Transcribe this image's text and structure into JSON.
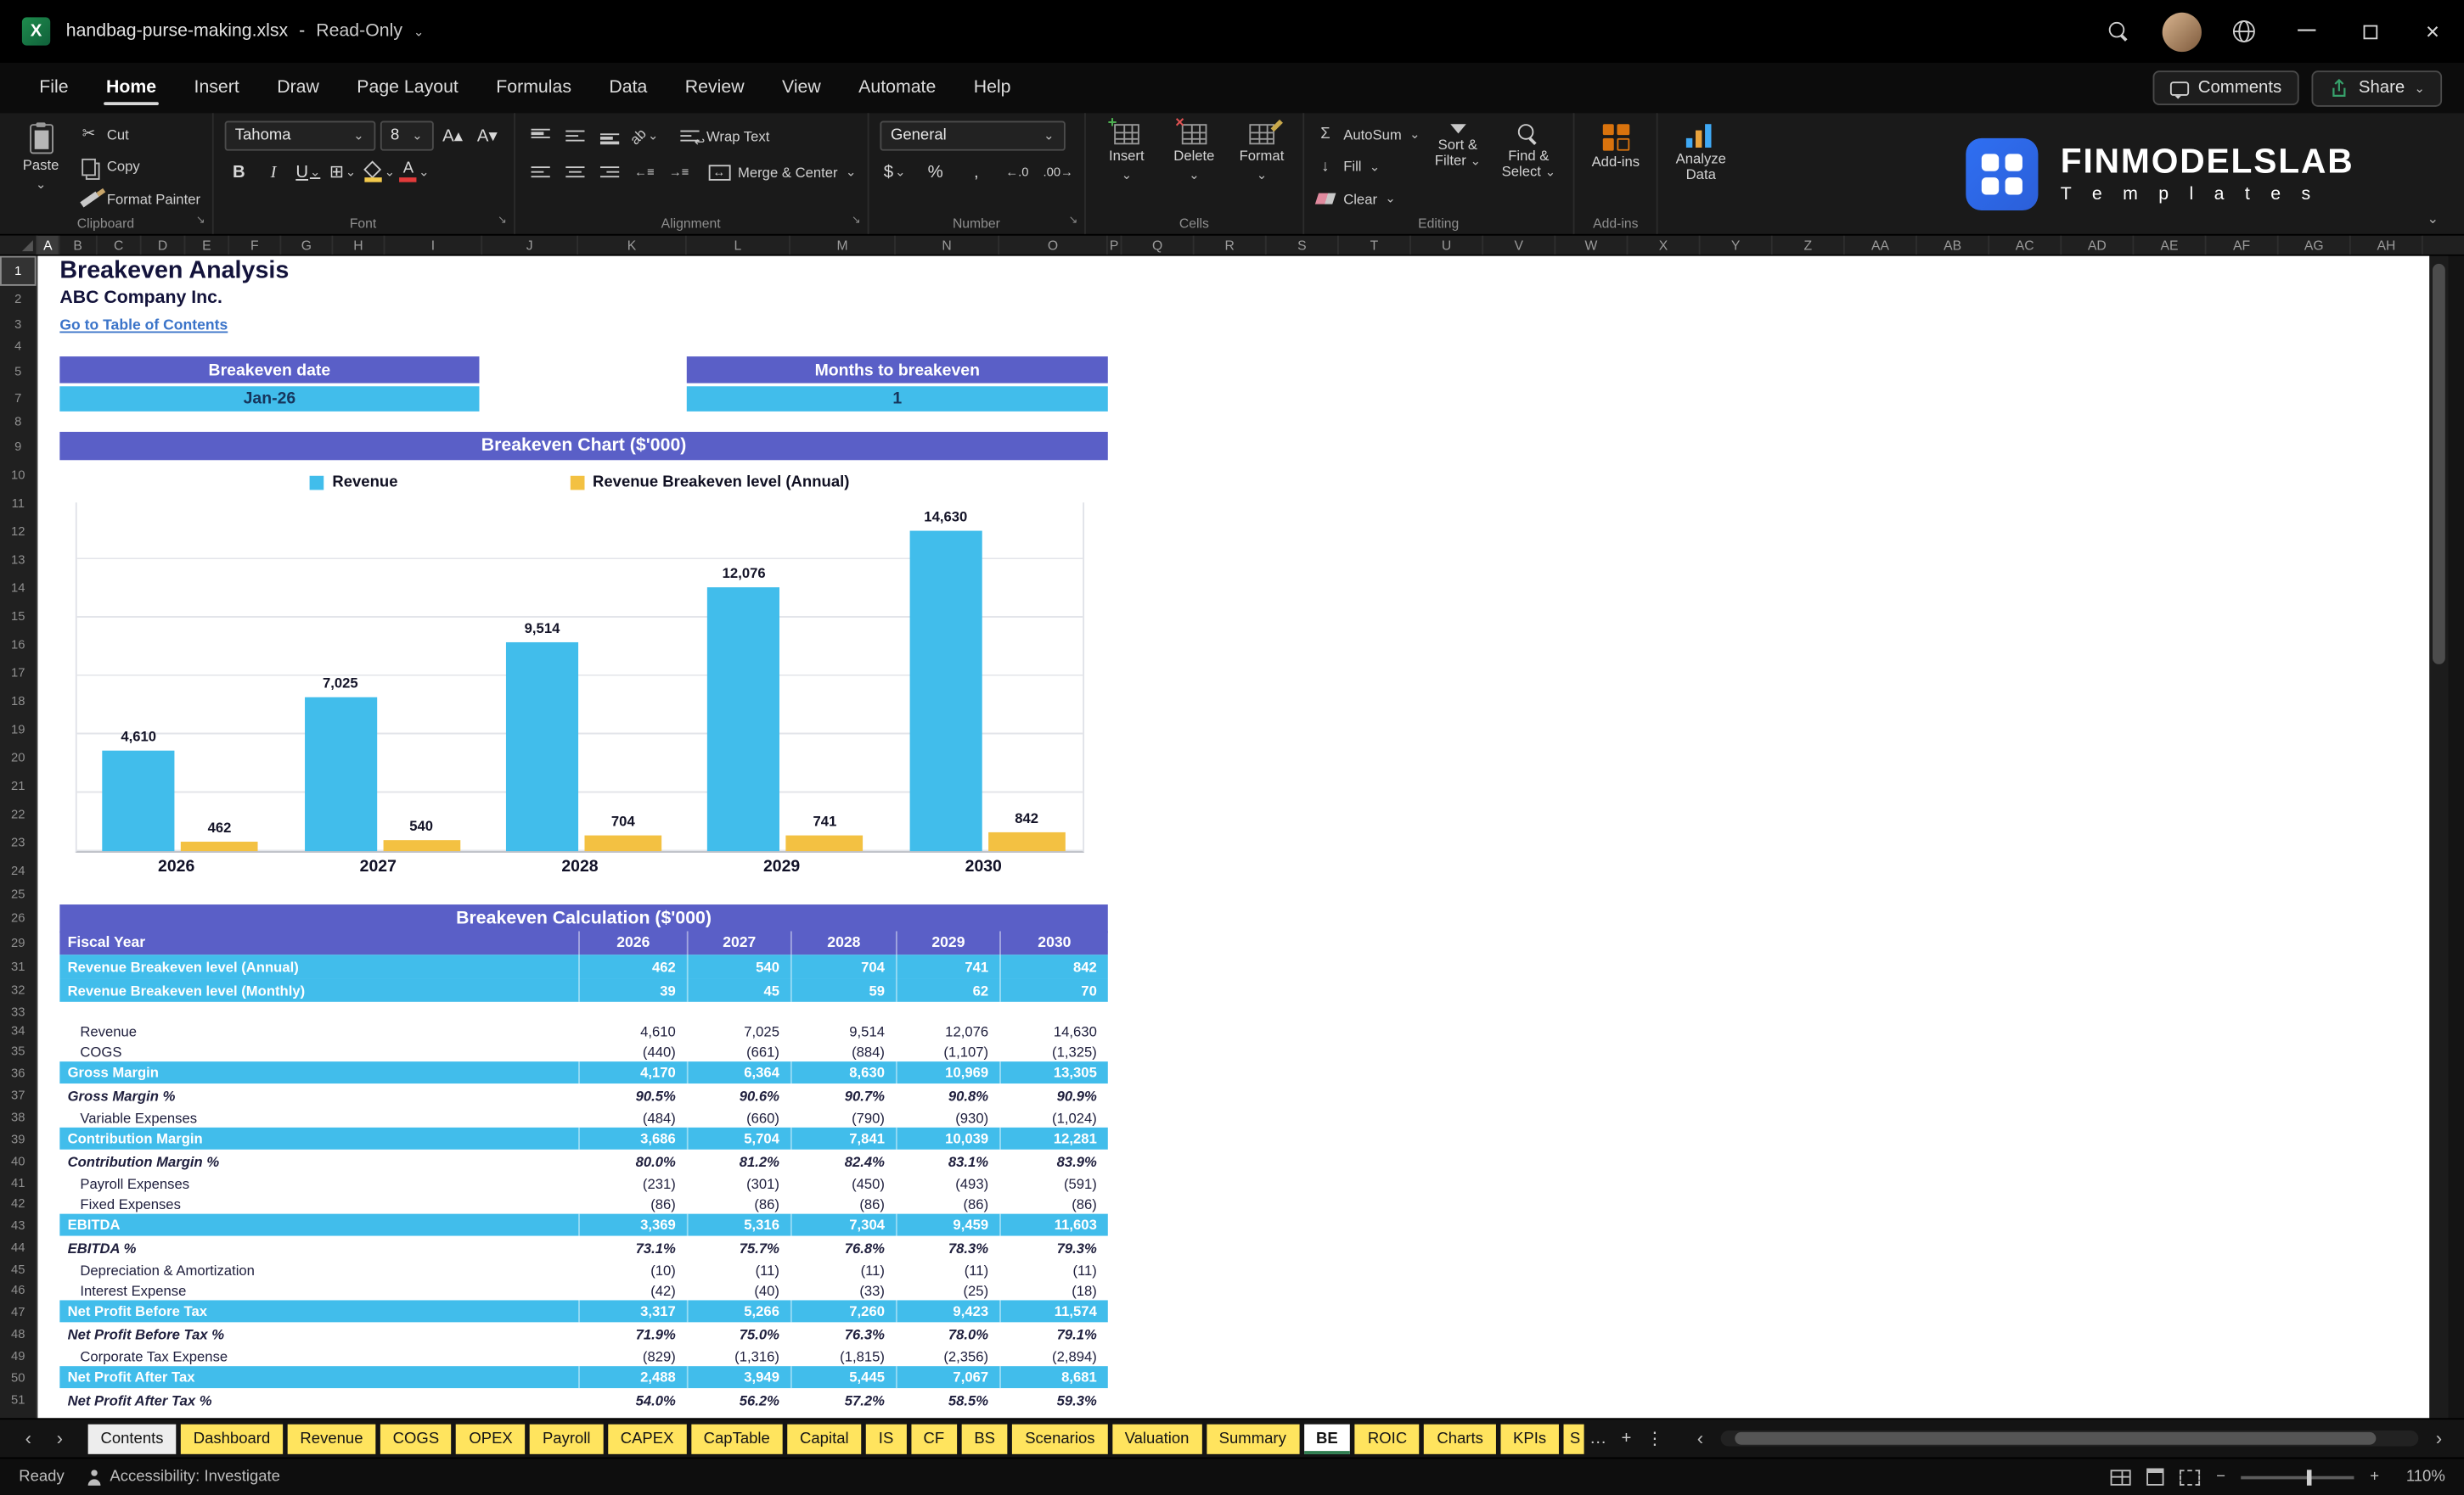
{
  "icons": {
    "chevron": "⌄",
    "dropdown": "▾",
    "scissors": "✂",
    "bold": "B",
    "italic": "I",
    "underline": "U",
    "border": "⊞",
    "sigma": "Σ",
    "fill_down": "↓",
    "wrap_arrow": "↩",
    "merge_arrow": "↔",
    "orientation": "ab",
    "minimize": "─",
    "close": "×",
    "nav_left": "‹",
    "nav_right": "›",
    "more": "…",
    "add_sheet": "+",
    "dots": "⋮",
    "dollar": "$",
    "percent": "%",
    "comma": ",",
    "dec_inc": "←.0",
    "dec_dec": ".00→",
    "font_up": "A▴",
    "font_down": "A▾"
  },
  "titlebar": {
    "filename": "handbag-purse-making.xlsx",
    "separator": "-",
    "mode": "Read-Only"
  },
  "menubar": {
    "items": [
      "File",
      "Home",
      "Insert",
      "Draw",
      "Page Layout",
      "Formulas",
      "Data",
      "Review",
      "View",
      "Automate",
      "Help"
    ],
    "active": "Home",
    "comments_label": "Comments",
    "share_label": "Share"
  },
  "ribbon": {
    "clipboard": {
      "label": "Clipboard",
      "paste": "Paste",
      "cut": "Cut",
      "copy": "Copy",
      "format_painter": "Format Painter"
    },
    "font": {
      "label": "Font",
      "family": "Tahoma",
      "size": "8"
    },
    "alignment": {
      "label": "Alignment",
      "wrap": "Wrap Text",
      "merge": "Merge & Center"
    },
    "number": {
      "label": "Number",
      "format": "General"
    },
    "cells": {
      "label": "Cells",
      "insert": "Insert",
      "delete": "Delete",
      "format": "Format"
    },
    "editing": {
      "label": "Editing",
      "autosum": "AutoSum",
      "fill": "Fill",
      "clear": "Clear",
      "sort1": "Sort &",
      "sort2": "Filter",
      "find1": "Find &",
      "find2": "Select"
    },
    "addins": {
      "label": "Add-ins",
      "addins": "Add-ins",
      "analyze1": "Analyze",
      "analyze2": "Data"
    },
    "logo": {
      "line1": "FINMODELSLAB",
      "line2": "T e m p l a t e s"
    }
  },
  "sheet": {
    "selected_col": "A",
    "selected_row": 1,
    "columns": [
      {
        "l": "A",
        "w": 14
      },
      {
        "l": "B",
        "w": 24
      },
      {
        "l": "C",
        "w": 28
      },
      {
        "l": "D",
        "w": 28
      },
      {
        "l": "E",
        "w": 28
      },
      {
        "l": "F",
        "w": 33
      },
      {
        "l": "G",
        "w": 33
      },
      {
        "l": "H",
        "w": 33
      },
      {
        "l": "I",
        "w": 62
      },
      {
        "l": "J",
        "w": 61
      },
      {
        "l": "K",
        "w": 69
      },
      {
        "l": "L",
        "w": 66
      },
      {
        "l": "M",
        "w": 67
      },
      {
        "l": "N",
        "w": 66
      },
      {
        "l": "O",
        "w": 69
      },
      {
        "l": "P",
        "w": 9
      },
      {
        "l": "Q",
        "w": 46
      },
      {
        "l": "R",
        "w": 46
      },
      {
        "l": "S",
        "w": 46
      },
      {
        "l": "T",
        "w": 46
      },
      {
        "l": "U",
        "w": 46
      },
      {
        "l": "V",
        "w": 46
      },
      {
        "l": "W",
        "w": 46
      },
      {
        "l": "X",
        "w": 46
      },
      {
        "l": "Y",
        "w": 46
      },
      {
        "l": "Z",
        "w": 46
      },
      {
        "l": "AA",
        "w": 46
      },
      {
        "l": "AB",
        "w": 46
      },
      {
        "l": "AC",
        "w": 46
      },
      {
        "l": "AD",
        "w": 46
      },
      {
        "l": "AE",
        "w": 46
      },
      {
        "l": "AF",
        "w": 46
      },
      {
        "l": "AG",
        "w": 46
      },
      {
        "l": "AH",
        "w": 46
      }
    ],
    "rows": [
      [
        1,
        19
      ],
      [
        2,
        16
      ],
      [
        3,
        16
      ],
      [
        4,
        13
      ],
      [
        5,
        18
      ],
      [
        7,
        17
      ],
      [
        8,
        13
      ],
      [
        9,
        18
      ],
      [
        10,
        18
      ],
      [
        11,
        18
      ],
      [
        12,
        18
      ],
      [
        13,
        18
      ],
      [
        14,
        18
      ],
      [
        15,
        18
      ],
      [
        16,
        18
      ],
      [
        17,
        18
      ],
      [
        18,
        18
      ],
      [
        19,
        18
      ],
      [
        20,
        18
      ],
      [
        21,
        18
      ],
      [
        22,
        18
      ],
      [
        23,
        18
      ],
      [
        24,
        18
      ],
      [
        25,
        13
      ],
      [
        26,
        17
      ],
      [
        29,
        15
      ],
      [
        31,
        15
      ],
      [
        32,
        15
      ],
      [
        33,
        12
      ],
      [
        34,
        13
      ],
      [
        35,
        13
      ],
      [
        36,
        14
      ],
      [
        37,
        15
      ],
      [
        38,
        13
      ],
      [
        39,
        14
      ],
      [
        40,
        15
      ],
      [
        41,
        13
      ],
      [
        42,
        13
      ],
      [
        43,
        14
      ],
      [
        44,
        15
      ],
      [
        45,
        13
      ],
      [
        46,
        13
      ],
      [
        47,
        14
      ],
      [
        48,
        15
      ],
      [
        49,
        13
      ],
      [
        50,
        14
      ],
      [
        51,
        15
      ]
    ],
    "title": "Breakeven Analysis",
    "company": "ABC Company Inc.",
    "toc_link": "Go to Table of Contents",
    "breakeven_date_label": "Breakeven date",
    "breakeven_date": "Jan-26",
    "months_label": "Months to breakeven",
    "months_value": "1",
    "chart_banner": "Breakeven Chart ($'000)",
    "calc_banner": "Breakeven Calculation ($'000)"
  },
  "chart_data": {
    "type": "bar",
    "title": "Breakeven Chart ($'000)",
    "categories": [
      "2026",
      "2027",
      "2028",
      "2029",
      "2030"
    ],
    "series": [
      {
        "name": "Revenue",
        "color": "#41BDEB",
        "values": [
          4610,
          7025,
          9514,
          12076,
          14630
        ],
        "labels": [
          "4,610",
          "7,025",
          "9,514",
          "12,076",
          "14,630"
        ]
      },
      {
        "name": "Revenue Breakeven level (Annual)",
        "color": "#F3C142",
        "values": [
          462,
          540,
          704,
          741,
          842
        ],
        "labels": [
          "462",
          "540",
          "704",
          "741",
          "842"
        ]
      }
    ],
    "ylim": [
      0,
      16000
    ],
    "gridline_intervals": 6,
    "legend_position": "top",
    "grid": true
  },
  "calc_table": {
    "header": {
      "label": "Fiscal Year",
      "years": [
        "2026",
        "2027",
        "2028",
        "2029",
        "2030"
      ]
    },
    "rows": [
      {
        "row": "31",
        "label": "Revenue Breakeven level (Annual)",
        "values": [
          "462",
          "540",
          "704",
          "741",
          "842"
        ],
        "style": "blue"
      },
      {
        "row": "32",
        "label": "Revenue Breakeven level (Monthly)",
        "values": [
          "39",
          "45",
          "59",
          "62",
          "70"
        ],
        "style": "blue"
      },
      {
        "row": "33",
        "label": "",
        "values": [
          "",
          "",
          "",
          "",
          ""
        ],
        "style": "spacer"
      },
      {
        "row": "34",
        "label": "Revenue",
        "values": [
          "4,610",
          "7,025",
          "9,514",
          "12,076",
          "14,630"
        ],
        "style": "normal"
      },
      {
        "row": "35",
        "label": "COGS",
        "values": [
          "(440)",
          "(661)",
          "(884)",
          "(1,107)",
          "(1,325)"
        ],
        "style": "normal"
      },
      {
        "row": "36",
        "label": "Gross Margin",
        "values": [
          "4,170",
          "6,364",
          "8,630",
          "10,969",
          "13,305"
        ],
        "style": "blue-sub"
      },
      {
        "row": "37",
        "label": "Gross Margin %",
        "values": [
          "90.5%",
          "90.6%",
          "90.7%",
          "90.8%",
          "90.9%"
        ],
        "style": "pct"
      },
      {
        "row": "38",
        "label": "Variable Expenses",
        "values": [
          "(484)",
          "(660)",
          "(790)",
          "(930)",
          "(1,024)"
        ],
        "style": "normal"
      },
      {
        "row": "39",
        "label": "Contribution Margin",
        "values": [
          "3,686",
          "5,704",
          "7,841",
          "10,039",
          "12,281"
        ],
        "style": "blue-sub"
      },
      {
        "row": "40",
        "label": "Contribution Margin %",
        "values": [
          "80.0%",
          "81.2%",
          "82.4%",
          "83.1%",
          "83.9%"
        ],
        "style": "pct"
      },
      {
        "row": "41",
        "label": "Payroll Expenses",
        "values": [
          "(231)",
          "(301)",
          "(450)",
          "(493)",
          "(591)"
        ],
        "style": "normal"
      },
      {
        "row": "42",
        "label": "Fixed Expenses",
        "values": [
          "(86)",
          "(86)",
          "(86)",
          "(86)",
          "(86)"
        ],
        "style": "normal"
      },
      {
        "row": "43",
        "label": "EBITDA",
        "values": [
          "3,369",
          "5,316",
          "7,304",
          "9,459",
          "11,603"
        ],
        "style": "blue-sub"
      },
      {
        "row": "44",
        "label": "EBITDA %",
        "values": [
          "73.1%",
          "75.7%",
          "76.8%",
          "78.3%",
          "79.3%"
        ],
        "style": "pct"
      },
      {
        "row": "45",
        "label": "Depreciation & Amortization",
        "values": [
          "(10)",
          "(11)",
          "(11)",
          "(11)",
          "(11)"
        ],
        "style": "normal"
      },
      {
        "row": "46",
        "label": "Interest Expense",
        "values": [
          "(42)",
          "(40)",
          "(33)",
          "(25)",
          "(18)"
        ],
        "style": "normal"
      },
      {
        "row": "47",
        "label": "Net Profit Before Tax",
        "values": [
          "3,317",
          "5,266",
          "7,260",
          "9,423",
          "11,574"
        ],
        "style": "blue-sub"
      },
      {
        "row": "48",
        "label": "Net Profit Before Tax %",
        "values": [
          "71.9%",
          "75.0%",
          "76.3%",
          "78.0%",
          "79.1%"
        ],
        "style": "pct"
      },
      {
        "row": "49",
        "label": "Corporate Tax Expense",
        "values": [
          "(829)",
          "(1,316)",
          "(1,815)",
          "(2,356)",
          "(2,894)"
        ],
        "style": "normal"
      },
      {
        "row": "50",
        "label": "Net Profit After Tax",
        "values": [
          "2,488",
          "3,949",
          "5,445",
          "7,067",
          "8,681"
        ],
        "style": "blue-sub"
      },
      {
        "row": "51",
        "label": "Net Profit After Tax %",
        "values": [
          "54.0%",
          "56.2%",
          "57.2%",
          "58.5%",
          "59.3%"
        ],
        "style": "pct"
      }
    ]
  },
  "tabs": {
    "items": [
      {
        "label": "Contents",
        "style": "light"
      },
      {
        "label": "Dashboard",
        "style": "yellow"
      },
      {
        "label": "Revenue",
        "style": "yellow"
      },
      {
        "label": "COGS",
        "style": "yellow"
      },
      {
        "label": "OPEX",
        "style": "yellow"
      },
      {
        "label": "Payroll",
        "style": "yellow"
      },
      {
        "label": "CAPEX",
        "style": "yellow"
      },
      {
        "label": "CapTable",
        "style": "yellow"
      },
      {
        "label": "Capital",
        "style": "yellow"
      },
      {
        "label": "IS",
        "style": "yellow"
      },
      {
        "label": "CF",
        "style": "yellow"
      },
      {
        "label": "BS",
        "style": "yellow"
      },
      {
        "label": "Scenarios",
        "style": "yellow"
      },
      {
        "label": "Valuation",
        "style": "yellow"
      },
      {
        "label": "Summary",
        "style": "yellow"
      },
      {
        "label": "BE",
        "style": "active"
      },
      {
        "label": "ROIC",
        "style": "yellow"
      },
      {
        "label": "Charts",
        "style": "yellow"
      },
      {
        "label": "KPIs",
        "style": "yellow"
      },
      {
        "label": "S",
        "style": "yellow",
        "w": 13
      }
    ]
  },
  "statusbar": {
    "ready": "Ready",
    "accessibility": "Accessibility: Investigate",
    "zoom": "110%",
    "zoom_minus": "−",
    "zoom_plus": "+"
  }
}
